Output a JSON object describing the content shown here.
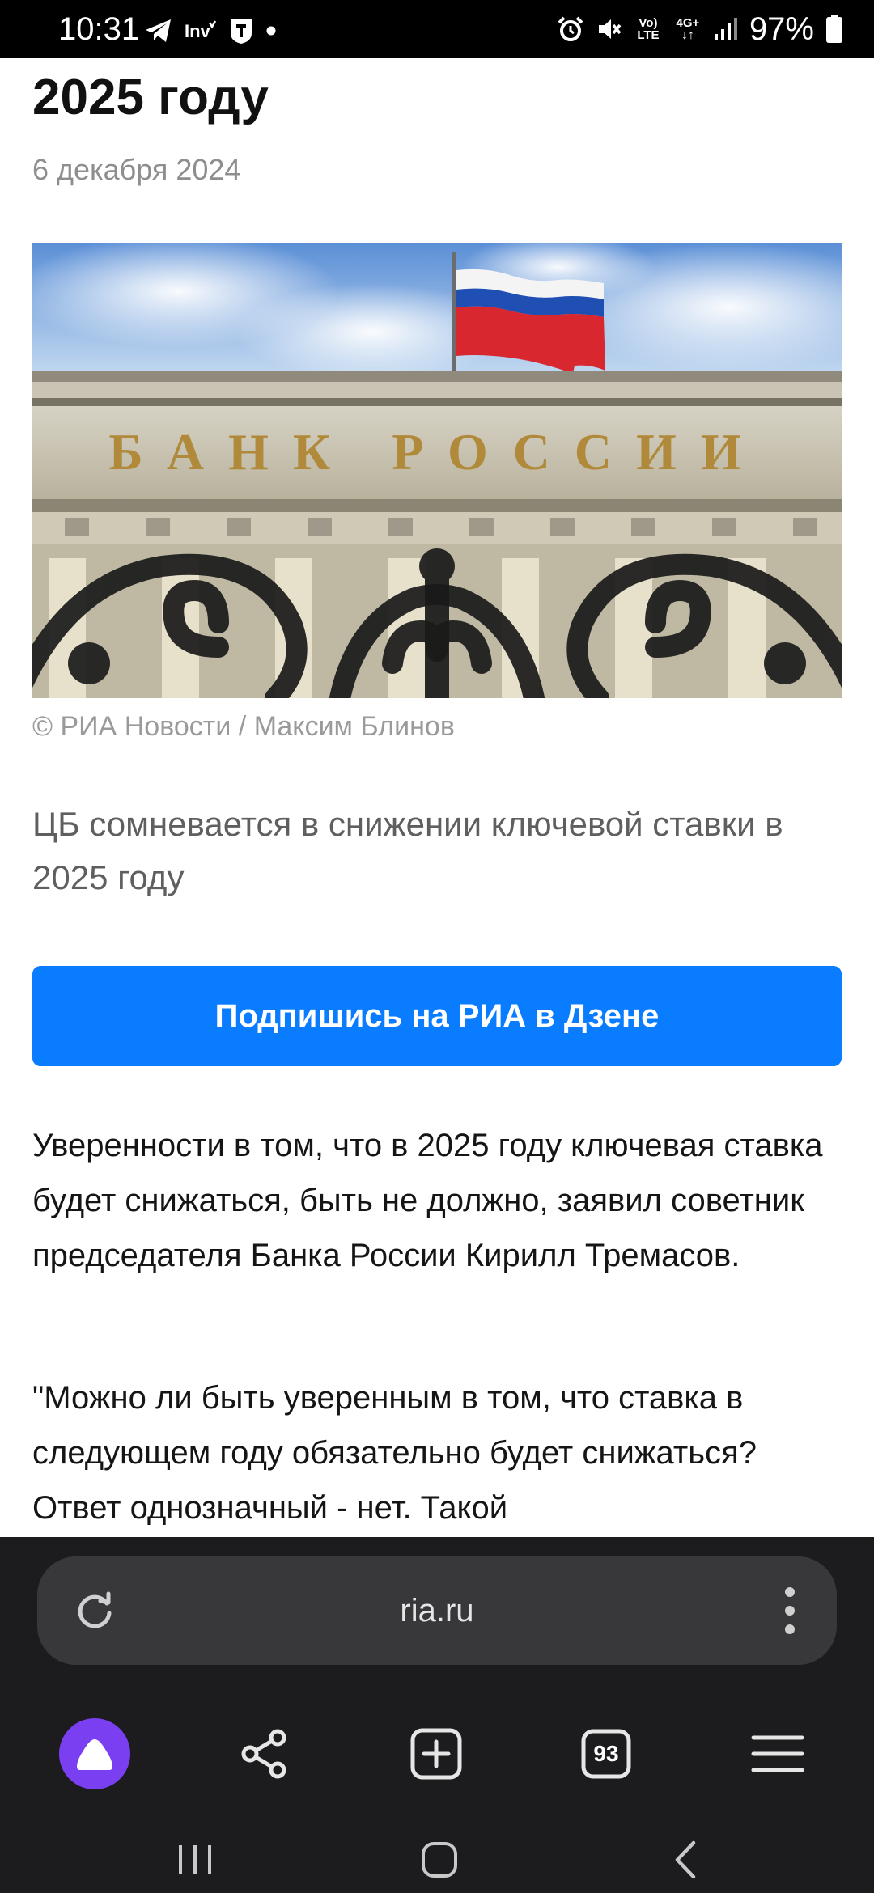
{
  "status_bar": {
    "time": "10:31",
    "notification_icons": [
      "telegram-icon",
      "investing-icon",
      "shield-app-icon",
      "dot-icon"
    ],
    "system_icons": [
      "alarm-icon",
      "mute-icon",
      "volte-icon",
      "4g-icon",
      "signal-icon"
    ],
    "volte_label": "Vo) LTE",
    "network_label": "4G+",
    "battery": "97%"
  },
  "article": {
    "title": "2025 году",
    "date": "6 декабря 2024",
    "photo": {
      "sign_text": "БАНК РОССИИ",
      "icon": "photo-bank-of-russia"
    },
    "photo_credit": "© РИА Новости / Максим Блинов",
    "lead": "ЦБ сомневается в снижении ключевой ставки в 2025 году",
    "subscribe_label": "Подпишись на РИА в Дзене",
    "paragraphs": [
      "Уверенности в том, что в 2025 году ключевая ставка будет снижаться, быть не должно, заявил советник председателя Банка России Кирилл Тремасов.",
      "\"Можно ли быть уверенным в том, что ставка в следующем году обязательно будет снижаться? Ответ однозначный - нет. Такой"
    ]
  },
  "browser": {
    "url": "ria.ru",
    "tabs_count": "93",
    "toolbar": [
      "alice-icon",
      "share-icon",
      "new-tab-icon",
      "tabs-icon",
      "menu-icon"
    ],
    "accent_color": "#0a7cff",
    "alice_color": "#7b3ff2"
  },
  "nav_bar": [
    "recent-apps-icon",
    "home-icon",
    "back-icon"
  ]
}
